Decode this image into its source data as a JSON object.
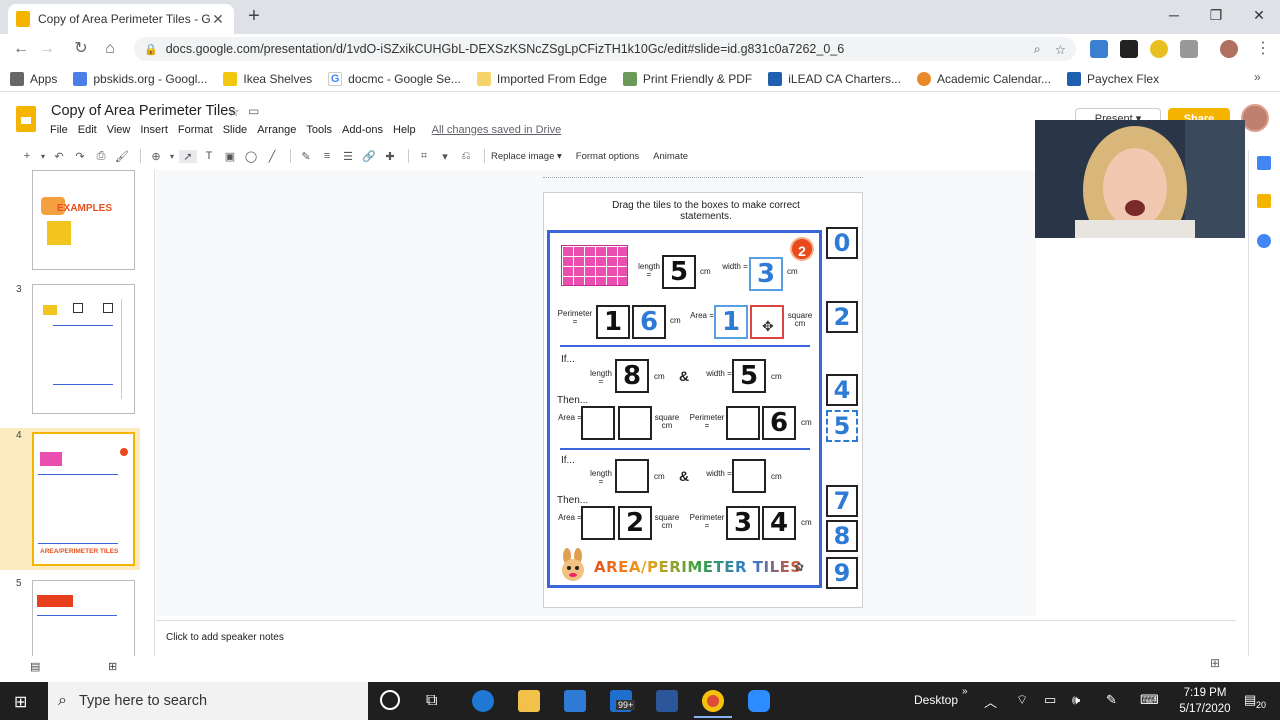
{
  "browser": {
    "tab_title": "Copy of Area Perimeter Tiles - Go",
    "url": "docs.google.com/presentation/d/1vdO-iSZxikCUHGbL-DEXSzKSNcZSgLpCFizTH1k10Gc/edit#slide=id.g831c0a7262_0_6",
    "bookmarks": [
      "Apps",
      "pbskids.org - Googl...",
      "Ikea Shelves",
      "docmc - Google Se...",
      "Imported From Edge",
      "Print Friendly & PDF",
      "iLEAD CA Charters...",
      "Academic Calendar...",
      "Paychex Flex"
    ]
  },
  "slides": {
    "doc_title": "Copy of Area Perimeter Tiles",
    "menu": [
      "File",
      "Edit",
      "View",
      "Insert",
      "Format",
      "Slide",
      "Arrange",
      "Tools",
      "Add-ons",
      "Help"
    ],
    "saved_status": "All changes saved in Drive",
    "toolbar": {
      "replace_image": "Replace image ▾",
      "format_options": "Format options",
      "animate": "Animate"
    },
    "present_label": "Present",
    "share_label": "Share",
    "notes_placeholder": "Click to add speaker notes",
    "thumb_numbers": [
      "3",
      "4",
      "5"
    ],
    "thumb_examples_label": "EXAMPLES"
  },
  "slide": {
    "instruction": "Drag the tiles to the boxes to make correct statements.",
    "badge": "2",
    "length_label": "length =",
    "width_label": "width =",
    "cm": "cm",
    "perimeter_label": "Perimeter =",
    "area_label": "Area =",
    "square_cm": "square cm",
    "if_label": "If...",
    "then_label": "Then...",
    "amp": "&",
    "row1": {
      "length": "5",
      "width": "3",
      "perimeter_1": "1",
      "perimeter_2": "6",
      "area_1": "1",
      "area_2": ""
    },
    "row2": {
      "length": "8",
      "width": "5",
      "area_1": "",
      "area_2": "",
      "perimeter_1": "",
      "perimeter_2": "6"
    },
    "row3": {
      "length": "",
      "width": "",
      "area_1": "",
      "area_2": "2",
      "perimeter_1": "3",
      "perimeter_2": "4"
    },
    "footer_title": "AREA/PERIMETER TILES",
    "tiles": [
      "0",
      "2",
      "4",
      "5",
      "7",
      "8",
      "9"
    ]
  },
  "taskbar": {
    "search_placeholder": "Type here to search",
    "desktop_label": "Desktop",
    "time": "7:19 PM",
    "date": "5/17/2020",
    "mail_badge": "99+",
    "notif_count": "20"
  }
}
